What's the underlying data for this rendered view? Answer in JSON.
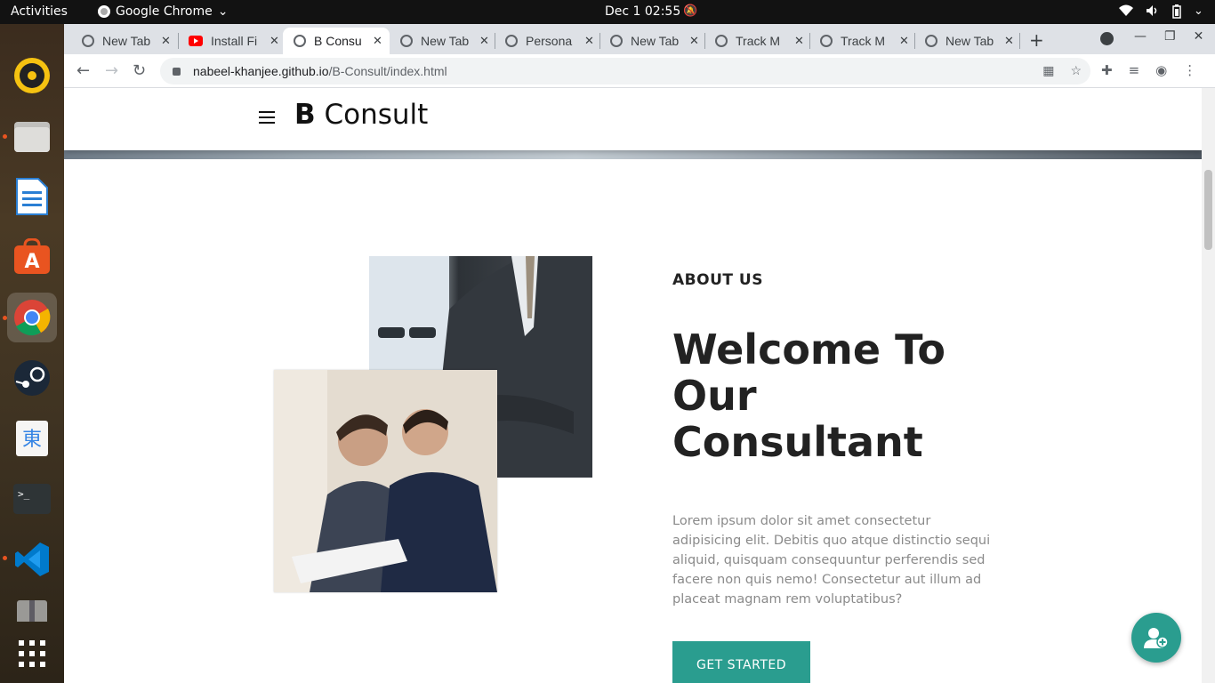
{
  "topbar": {
    "activities": "Activities",
    "app_name": "Google Chrome",
    "clock": "Dec 1  02:55"
  },
  "dock": {
    "items": [
      "rhythmbox-icon",
      "files-icon",
      "writer-icon",
      "software-icon",
      "chrome-icon",
      "steam-icon",
      "input-method-icon",
      "terminal-icon",
      "vscode-icon",
      "archive-icon",
      "app-grid-icon"
    ]
  },
  "browser": {
    "tabs": [
      {
        "title": "New Tab",
        "favicon": "chrome-icon",
        "active": false
      },
      {
        "title": "Install Fi",
        "favicon": "youtube-icon",
        "active": false
      },
      {
        "title": "B Consu",
        "favicon": "globe-icon",
        "active": true
      },
      {
        "title": "New Tab",
        "favicon": "chrome-icon",
        "active": false
      },
      {
        "title": "Persona",
        "favicon": "globe-icon",
        "active": false
      },
      {
        "title": "New Tab",
        "favicon": "chrome-icon",
        "active": false
      },
      {
        "title": "Track M",
        "favicon": "chrome-icon",
        "active": false
      },
      {
        "title": "Track M",
        "favicon": "globe-icon",
        "active": false
      },
      {
        "title": "New Tab",
        "favicon": "chrome-icon",
        "active": false
      }
    ],
    "url_host": "nabeel-khanjee.github.io",
    "url_path": "/B-Consult/index.html"
  },
  "site": {
    "brand_bold": "B",
    "brand_rest": " Consult",
    "about_label": "ABOUT US",
    "about_heading": "Welcome To Our Consultant",
    "about_body": "Lorem ipsum dolor sit amet consectetur adipisicing elit. Debitis quo atque distinctio sequi aliquid, quisquam consequuntur perferendis sed facere non quis nemo! Consectetur aut illum ad placeat magnam rem voluptatibus?",
    "cta_label": "GET STARTED",
    "accent_color": "#2a9d8f"
  }
}
